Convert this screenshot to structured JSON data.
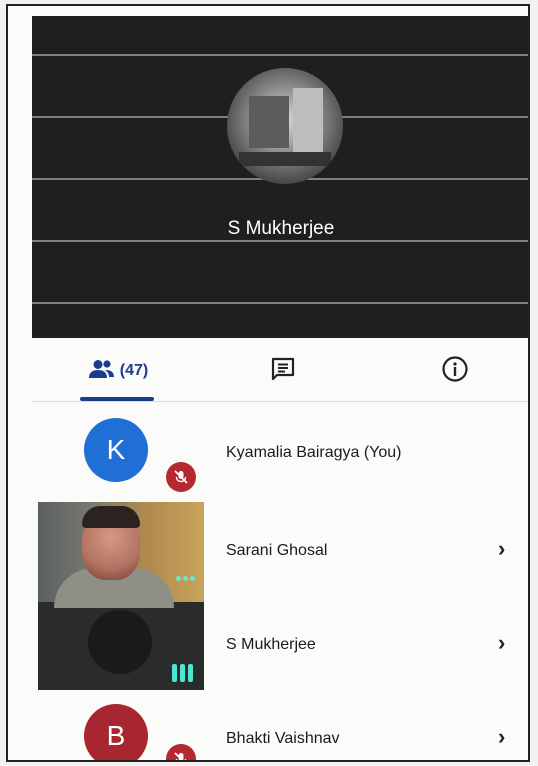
{
  "speaker": {
    "name": "S Mukherjee"
  },
  "tabs": {
    "people_count": "(47)",
    "active_color": "#1a3c8c"
  },
  "participants": [
    {
      "name": "Kyamalia Bairagya (You)",
      "avatar_letter": "K",
      "avatar_color": "#1f6fd6",
      "mic": "muted"
    },
    {
      "name": "Sarani Ghosal",
      "video": true
    },
    {
      "name": "S Mukherjee",
      "video": true
    },
    {
      "name": "Bhakti Vaishnav",
      "avatar_letter": "B",
      "avatar_color": "#a8262f",
      "mic": "muted"
    }
  ],
  "icons": {
    "people_tab": "people-icon",
    "chat_tab": "chat-icon",
    "info_tab": "info-icon",
    "mic_off": "mic-off-icon",
    "chevron": "chevron-right-icon"
  }
}
